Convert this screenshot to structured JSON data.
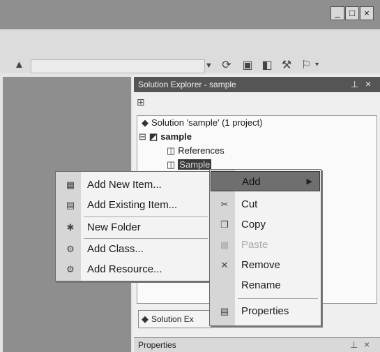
{
  "window": {
    "buttons": {
      "minimize": "_",
      "maximize": "□",
      "close": "×"
    }
  },
  "toolbar": {
    "combo_value": "",
    "icons": [
      "refresh-icon",
      "open-icon",
      "folder-icon",
      "tools-icon",
      "dropdown-tool-icon"
    ]
  },
  "solution_explorer": {
    "title": "Solution Explorer - sample",
    "tree": [
      {
        "label": "Solution 'sample' (1 project)"
      },
      {
        "label": "sample"
      },
      {
        "label": "References"
      },
      {
        "label": "Sample"
      }
    ],
    "tab_label": "Solution Ex"
  },
  "properties": {
    "title": "Properties"
  },
  "context_menu": {
    "items": [
      {
        "label": "Add",
        "icon": "",
        "state": "selected",
        "has_submenu": true
      },
      {
        "label": "Cut",
        "icon": "cut-icon",
        "state": "normal"
      },
      {
        "label": "Copy",
        "icon": "copy-icon",
        "state": "normal"
      },
      {
        "label": "Paste",
        "icon": "paste-icon",
        "state": "disabled"
      },
      {
        "label": "Remove",
        "icon": "remove-icon",
        "state": "normal"
      },
      {
        "label": "Rename",
        "icon": "",
        "state": "normal"
      },
      {
        "label": "Properties",
        "icon": "properties-icon",
        "state": "normal"
      }
    ]
  },
  "add_submenu": {
    "items": [
      {
        "label": "Add New Item...",
        "icon": "new-item-icon",
        "state": "normal"
      },
      {
        "label": "Add Existing Item...",
        "icon": "existing-item-icon",
        "state": "normal"
      },
      {
        "label": "New Folder",
        "icon": "new-folder-icon",
        "state": "normal"
      },
      {
        "label": "Add Class...",
        "icon": "add-class-icon",
        "state": "normal"
      },
      {
        "label": "Add Resource...",
        "icon": "add-resource-icon",
        "state": "normal"
      }
    ]
  },
  "colors": {
    "highlight": "#6f6f6f",
    "header": "#555555",
    "editor_bg": "#8e8e8e"
  }
}
